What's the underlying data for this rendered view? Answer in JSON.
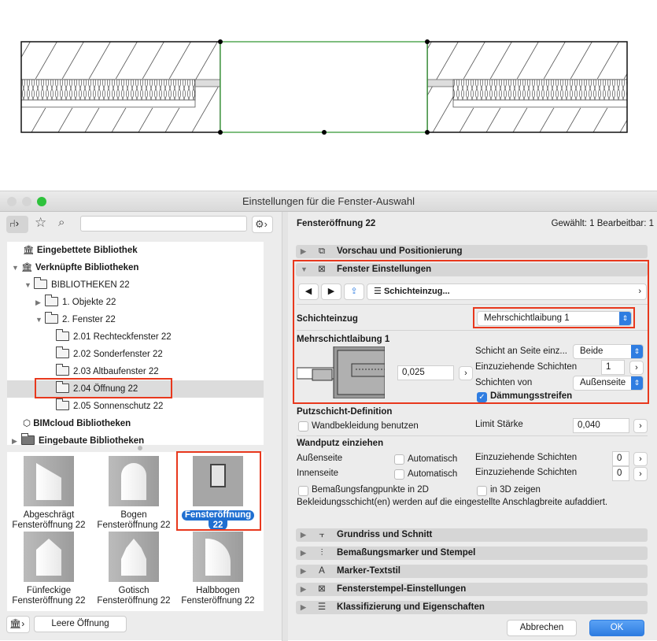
{
  "dialog": {
    "title": "Einstellungen für die Fenster-Auswahl"
  },
  "left": {
    "search": {
      "placeholder": "",
      "value": ""
    },
    "tree": [
      {
        "label": "Eingebettete Bibliothek"
      },
      {
        "label": "Verknüpfte Bibliotheken"
      },
      {
        "label": "BIBLIOTHEKEN 22"
      },
      {
        "label": "1. Objekte 22"
      },
      {
        "label": "2. Fenster 22"
      },
      {
        "label": "2.01 Rechteckfenster 22"
      },
      {
        "label": "2.02 Sonderfenster 22"
      },
      {
        "label": "2.03 Altbaufenster 22"
      },
      {
        "label": "2.04 Öffnung 22"
      },
      {
        "label": "2.05 Sonnenschutz 22"
      },
      {
        "label": "BIMcloud Bibliotheken"
      },
      {
        "label": "Eingebaute Bibliotheken"
      }
    ],
    "objects": [
      {
        "line1": "Abgeschrägt",
        "line2": "Fensteröffnung 22"
      },
      {
        "line1": "Bogen",
        "line2": "Fensteröffnung 22"
      },
      {
        "line1": "Fensteröffnung",
        "line2": "22"
      },
      {
        "line1": "Fünfeckige",
        "line2": "Fensteröffnung 22"
      },
      {
        "line1": "Gotisch",
        "line2": "Fensteröffnung 22"
      },
      {
        "line1": "Halbbogen",
        "line2": "Fensteröffnung 22"
      }
    ],
    "empty_button": "Leere Öffnung"
  },
  "right": {
    "object_name": "Fensteröffnung 22",
    "selection_info": "Gewählt: 1 Bearbeitbar: 1",
    "sections": {
      "preview": "Vorschau und Positionierung",
      "window": "Fenster Einstellungen",
      "floorplan": "Grundriss und Schnitt",
      "dimension": "Bemaßungsmarker und Stempel",
      "textstyle": "Marker-Textstil",
      "stamp": "Fensterstempel-Einstellungen",
      "classification": "Klassifizierung und Eigenschaften"
    },
    "page_nav": "Schichteinzug...",
    "schichteinzug_label": "Schichteinzug",
    "schichteinzug_value": "Mehrschichtlaibung 1",
    "mehr_title": "Mehrschichtlaibung 1",
    "offset_value": "0,025",
    "side_label": "Schicht an Seite einz...",
    "side_value": "Beide",
    "layers_label": "Einzuziehende Schichten",
    "layers_value": "1",
    "from_label": "Schichten von",
    "from_value": "Außenseite",
    "insulation_label": "Dämmungsstreifen",
    "putz_title": "Putzschicht-Definition",
    "wall_cover_label": "Wandbekleidung benutzen",
    "limit_label": "Limit Stärke",
    "limit_value": "0,040",
    "wandputz_title": "Wandputz einziehen",
    "outside_label": "Außenseite",
    "inside_label": "Innenseite",
    "auto_label": "Automatisch",
    "outside_layers_label": "Einzuziehende Schichten",
    "outside_layers_value": "0",
    "inside_layers_label": "Einzuziehende Schichten",
    "inside_layers_value": "0",
    "dim_points_label": "Bemaßungsfangpunkte in 2D",
    "show3d_label": "in 3D zeigen",
    "note": "Bekleidungsschicht(en) werden auf die eingestellte Anschlagbreite aufaddiert."
  },
  "buttons": {
    "cancel": "Abbrechen",
    "ok": "OK"
  },
  "colors": {
    "highlight": "#e8381d",
    "accent": "#2f7de1",
    "opening": "#3a9a3a"
  }
}
